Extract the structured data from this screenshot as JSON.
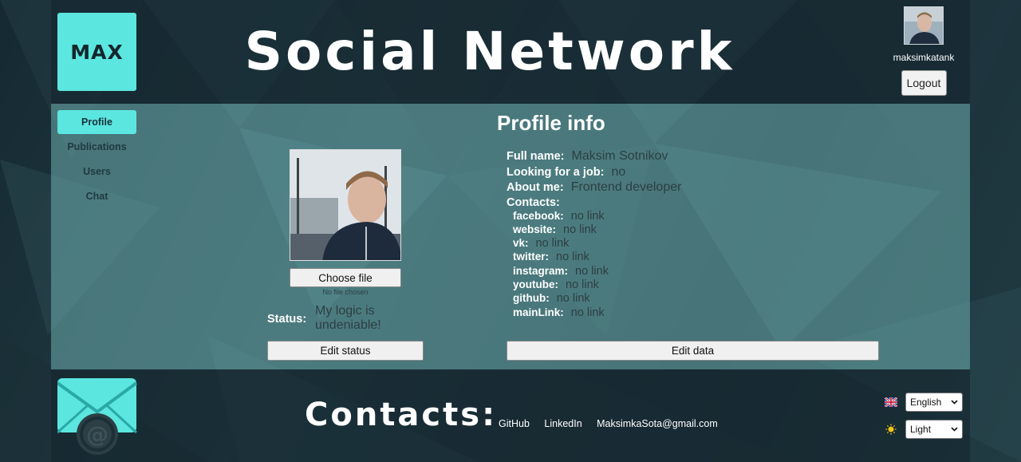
{
  "header": {
    "logo_text": "MAX",
    "title": "Social Network",
    "user": {
      "name": "maksimkatank",
      "logout_label": "Logout"
    }
  },
  "sidebar": {
    "items": [
      {
        "label": "Profile",
        "active": true
      },
      {
        "label": "Publications",
        "active": false
      },
      {
        "label": "Users",
        "active": false
      },
      {
        "label": "Chat",
        "active": false
      }
    ]
  },
  "profile": {
    "choose_file_label": "Choose file",
    "file_status": "No file chosen",
    "status_label": "Status:",
    "status_value": "My logic is undeniable!",
    "edit_status_label": "Edit status",
    "info_title": "Profile info",
    "full_name_label": "Full name:",
    "full_name": "Maksim Sotnikov",
    "job_label": "Looking for a job:",
    "job_value": "no",
    "about_label": "About me:",
    "about_value": "Frontend developer",
    "contacts_label": "Contacts:",
    "contacts": [
      {
        "key": "facebook:",
        "value": "no link"
      },
      {
        "key": "website:",
        "value": "no link"
      },
      {
        "key": "vk:",
        "value": "no link"
      },
      {
        "key": "twitter:",
        "value": "no link"
      },
      {
        "key": "instagram:",
        "value": "no link"
      },
      {
        "key": "youtube:",
        "value": "no link"
      },
      {
        "key": "github:",
        "value": "no link"
      },
      {
        "key": "mainLink:",
        "value": "no link"
      }
    ],
    "edit_data_label": "Edit data"
  },
  "footer": {
    "contacts_title": "Contacts:",
    "links": [
      "GitHub",
      "LinkedIn",
      "MaksimkaSota@gmail.com"
    ],
    "language": {
      "selected": "English",
      "icon": "uk-flag-icon"
    },
    "theme": {
      "selected": "Light",
      "icon": "sun-icon"
    }
  },
  "colors": {
    "accent": "#5ce6e0",
    "header_bg": "#1a2d35",
    "main_bg": "#6eafaf",
    "value_text": "#2c3f44"
  }
}
